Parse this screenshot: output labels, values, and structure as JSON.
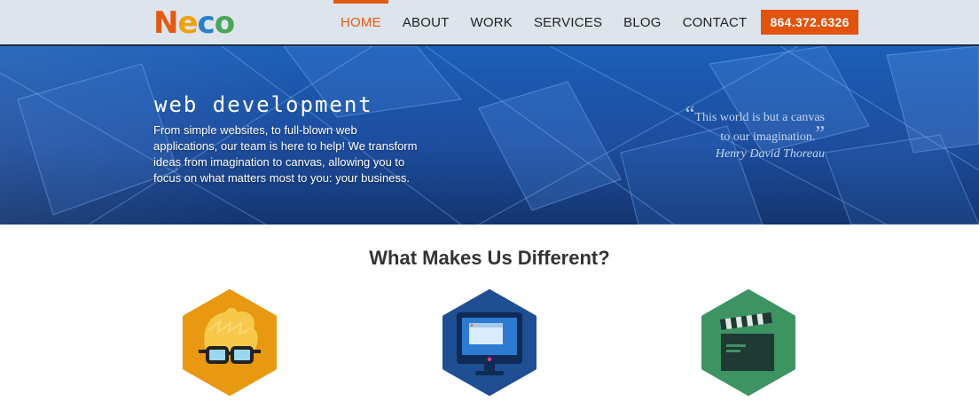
{
  "header": {
    "logo": {
      "letters": [
        "N",
        "e",
        "c",
        "o"
      ],
      "colors": [
        "#e35a12",
        "#f0a20d",
        "#2a7fc6",
        "#4aa558"
      ]
    },
    "nav": [
      {
        "label": "HOME",
        "active": true
      },
      {
        "label": "ABOUT"
      },
      {
        "label": "WORK"
      },
      {
        "label": "SERVICES"
      },
      {
        "label": "BLOG"
      },
      {
        "label": "CONTACT"
      }
    ],
    "phone": "864.372.6326"
  },
  "hero": {
    "title": "web development",
    "text": "From simple websites, to full-blown web applications, our team is here to help! We transform ideas from imagination to canvas, allowing you to focus on what matters most to you: your business.",
    "quote": {
      "open_mark": "“",
      "line1": "This world is but a canvas",
      "line2": "to our imagination.",
      "close_mark": "”",
      "author": "Henry David Thoreau"
    }
  },
  "section": {
    "title": "What Makes Us Different?",
    "features": [
      {
        "icon": "nerd-glasses-icon",
        "color": "#e99812"
      },
      {
        "icon": "computer-monitor-icon",
        "color": "#1f4e92"
      },
      {
        "icon": "clapperboard-icon",
        "color": "#3e9363"
      }
    ]
  }
}
